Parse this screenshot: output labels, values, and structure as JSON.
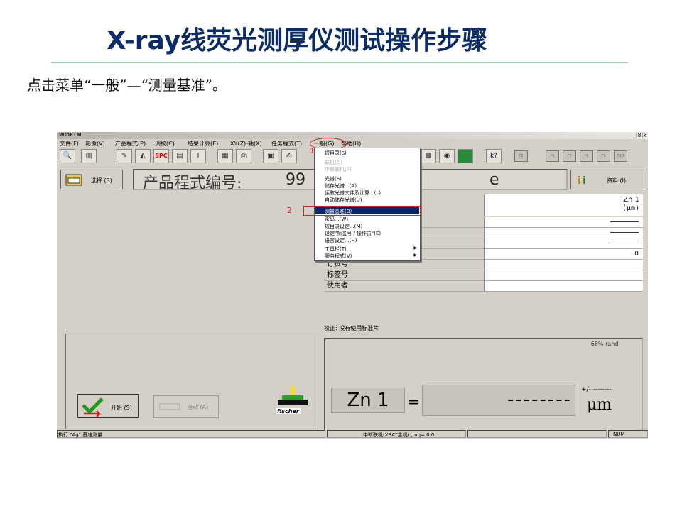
{
  "slide": {
    "title": "X-ray线荧光测厚仪测试操作步骤",
    "instruction": "点击菜单“一般”—“测量基准”。"
  },
  "window": {
    "title": "WinFTM",
    "buttons": "_|8|x",
    "menu": [
      "文件(F)",
      "影像(V)",
      "产品程式(P)",
      "调校(C)",
      "结果计算(E)",
      "XY(Z)-轴(X)",
      "任务程式(T)",
      "一般(G)",
      "帮助(H)"
    ]
  },
  "toolbar": {
    "right_buttons": [
      "F5",
      "F6",
      "F7",
      "F8",
      "F9",
      "F10"
    ]
  },
  "panel": {
    "select_button": "选择 (S)",
    "program_label": "产品程式编号:",
    "program_number": "99",
    "program_suffix": "e",
    "data_button": "资料 (I)"
  },
  "table": {
    "element": "Zn 1",
    "unit": "(μm)",
    "rows": [
      {
        "label": "",
        "value": "dash"
      },
      {
        "label": "",
        "value": "dash"
      },
      {
        "label": "",
        "value": "dash"
      },
      {
        "label": "",
        "value": "0"
      },
      {
        "label": "订货号",
        "value": ""
      },
      {
        "label": "标签号",
        "value": ""
      },
      {
        "label": "使用者",
        "value": ""
      }
    ],
    "calibration": "校正: 没有使用标准片"
  },
  "result": {
    "rand": "68% rand.",
    "element": "Zn 1",
    "equals": "=",
    "value": "--------",
    "plusminus": "+/- --------",
    "unit": "μm"
  },
  "bottom": {
    "start_button": "开始 (S)",
    "auto_button": "自动 (A)",
    "brand": "fischer"
  },
  "dropdown": {
    "items": [
      {
        "label": "短目录(S)",
        "disabled": false
      },
      {
        "label": "联机(O)",
        "disabled": true
      },
      {
        "label": "中断联机(F)",
        "disabled": true
      },
      {
        "label": "光谱(S)",
        "disabled": false
      },
      {
        "label": "储存光谱...(A)",
        "disabled": false
      },
      {
        "label": "读取光谱文件及计算...(L)",
        "disabled": false
      },
      {
        "label": "自动储存光谱(U)",
        "disabled": false
      },
      {
        "label": "测量基准(B)",
        "disabled": false,
        "highlight": true
      },
      {
        "label": "密码...(W)",
        "disabled": false
      },
      {
        "label": "短目录设定...(M)",
        "disabled": false
      },
      {
        "label": "设定\"标签号 / 操作员\"(E)",
        "disabled": false
      },
      {
        "label": "语言设定...(H)",
        "disabled": false
      },
      {
        "label": "工具栏(T)",
        "disabled": false,
        "submenu": true
      },
      {
        "label": "服务程式(V)",
        "disabled": false,
        "submenu": true
      }
    ],
    "marker1": "1",
    "marker2": "2"
  },
  "status": {
    "left": "执行 \"Ag\" 基准测量",
    "middle": "中断联机(XRAY主机) ,mq= 0.0",
    "num": "NUM"
  },
  "colors": {
    "title": "#0b2c66",
    "highlight": "#0a246a",
    "annotation": "#e02020"
  }
}
